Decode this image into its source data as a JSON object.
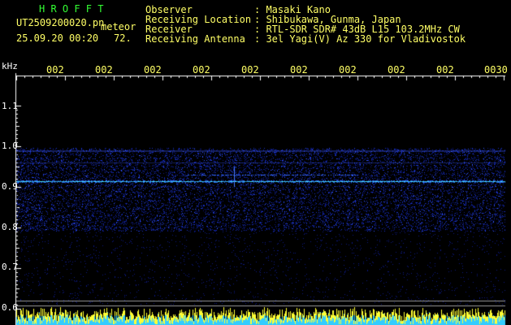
{
  "header": {
    "brand": "H R O F F T",
    "filename": "UT2509200020.pn",
    "filename_suffix": "meteor",
    "datetime": "25.09.20 00:20",
    "count": "72.",
    "info": [
      {
        "label": "Observer",
        "value": ": Masaki Kano"
      },
      {
        "label": "Receiving Location",
        "value": ": Shibukawa, Gunma, Japan"
      },
      {
        "label": "Receiver",
        "value": ": RTL-SDR SDR# 43dB L15 103.2MHz CW"
      },
      {
        "label": "Receiving Antenna",
        "value": ": 3el Yagi(V) Az 330 for Vladivostok"
      }
    ]
  },
  "colors": {
    "text_green": "#33ff33",
    "text_yellow": "#ffff66",
    "axis_white": "#ffffff",
    "echo_cyan": "#44ddff",
    "noise_blue": "#1a33cc",
    "level_yellow": "#ffff33",
    "level_cyan": "#33ccff"
  },
  "spectrogram": {
    "y_unit": "kHz",
    "y_ticks": [
      "1.1",
      "1.0",
      "0.9",
      "0.8",
      "0.7",
      "0.6"
    ],
    "y_range": [
      0.6,
      1.1
    ],
    "x_ticks": [
      "002",
      "002",
      "002",
      "002",
      "002",
      "002",
      "002",
      "002",
      "002",
      "0030"
    ],
    "carrier_khz": 0.915,
    "noise_band_khz": [
      0.79,
      0.995
    ]
  }
}
